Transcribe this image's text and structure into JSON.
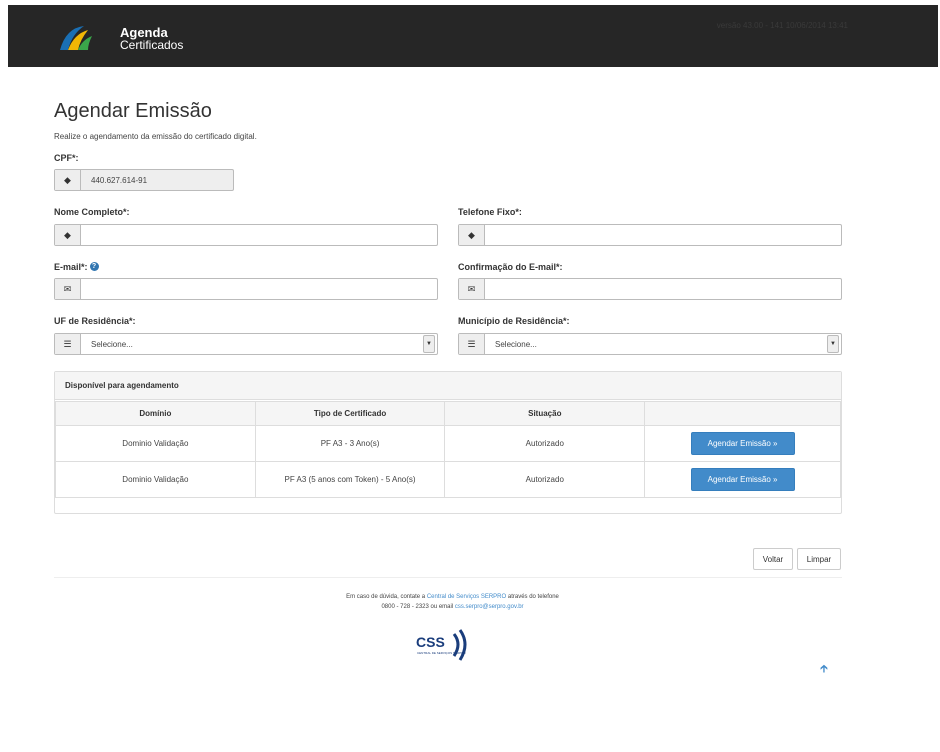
{
  "header": {
    "logo_line1": "Agenda",
    "logo_line2": "Certificados",
    "version": "versão 43.00 - 141 10/06/2014 13:41"
  },
  "page": {
    "title": "Agendar Emissão",
    "subtitle": "Realize o agendamento da emissão do certificado digital."
  },
  "form": {
    "cpf_label": "CPF*:",
    "cpf_value": "440.627.614-91",
    "nome_label": "Nome Completo*:",
    "telefone_label": "Telefone Fixo*:",
    "email_label": "E-mail*:",
    "email_conf_label": "Confirmação do E-mail*:",
    "uf_label": "UF de Residência*:",
    "uf_value": "Selecione...",
    "municipio_label": "Município de Residência*:",
    "municipio_value": "Selecione..."
  },
  "panel": {
    "title": "Disponível para agendamento",
    "columns": [
      "Domínio",
      "Tipo de Certificado",
      "Situação",
      ""
    ],
    "rows": [
      {
        "dominio": "Dominio Validação",
        "tipo": "PF A3 - 3 Ano(s)",
        "situacao": "Autorizado",
        "action": "Agendar Emissão »"
      },
      {
        "dominio": "Dominio Validação",
        "tipo": "PF A3 (5 anos com Token) - 5 Ano(s)",
        "situacao": "Autorizado",
        "action": "Agendar Emissão »"
      }
    ]
  },
  "buttons": {
    "voltar": "Voltar",
    "limpar": "Limpar"
  },
  "footer": {
    "text1": "Em caso de dúvida, contate a ",
    "link1": "Central de Serviços SERPRO",
    "text2": " através do telefone 0800 - 728 - 2323 ou email ",
    "link2": "css.serpro@serpro.gov.br",
    "logo_text": "CSS",
    "logo_sub": "CENTRAL DE SERVIÇOS SERPRO"
  },
  "colors": {
    "topbar": "#262626",
    "primary": "#428bca",
    "logo_blue": "#1a6fb4",
    "logo_yellow": "#f2b705",
    "logo_green": "#3aa64a"
  }
}
